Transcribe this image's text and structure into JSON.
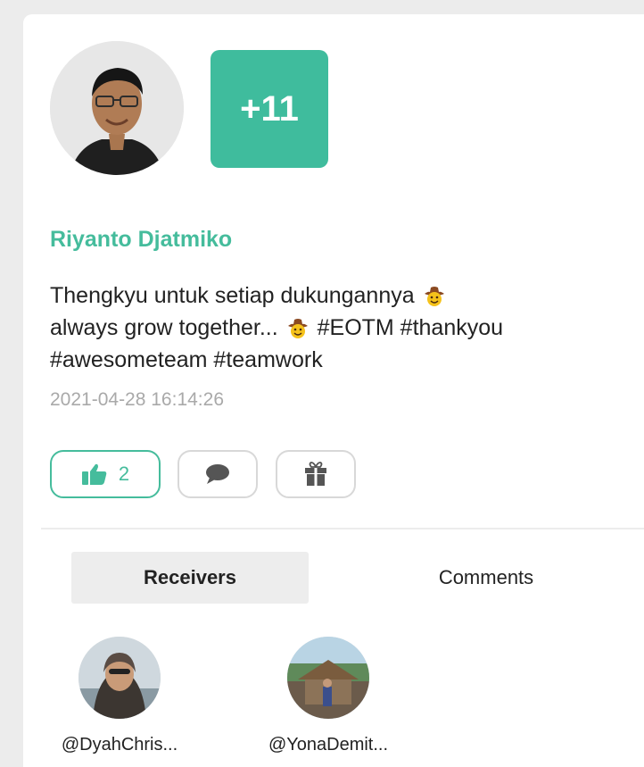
{
  "post": {
    "badge": "+11",
    "author": "Riyanto Djatmiko",
    "text_line1": "Thengkyu untuk setiap dukungannya",
    "text_line2a": "always grow together...",
    "text_line2b": "#EOTM #thankyou",
    "text_line3": "#awesometeam #teamwork",
    "emoji": "cowboy-face-icon",
    "timestamp": "2021-04-28 16:14:26"
  },
  "actions": {
    "like_count": "2",
    "like_icon": "thumbs-up-icon",
    "comment_icon": "speech-bubble-icon",
    "gift_icon": "gift-icon"
  },
  "tabs": [
    {
      "label": "Receivers",
      "active": true
    },
    {
      "label": "Comments",
      "active": false
    }
  ],
  "receivers": [
    {
      "handle": "@DyahChris..."
    },
    {
      "handle": "@YonaDemit..."
    }
  ],
  "colors": {
    "accent": "#45bc9c",
    "badge": "#3fbc9d",
    "timestamp": "#a9a9a9"
  }
}
